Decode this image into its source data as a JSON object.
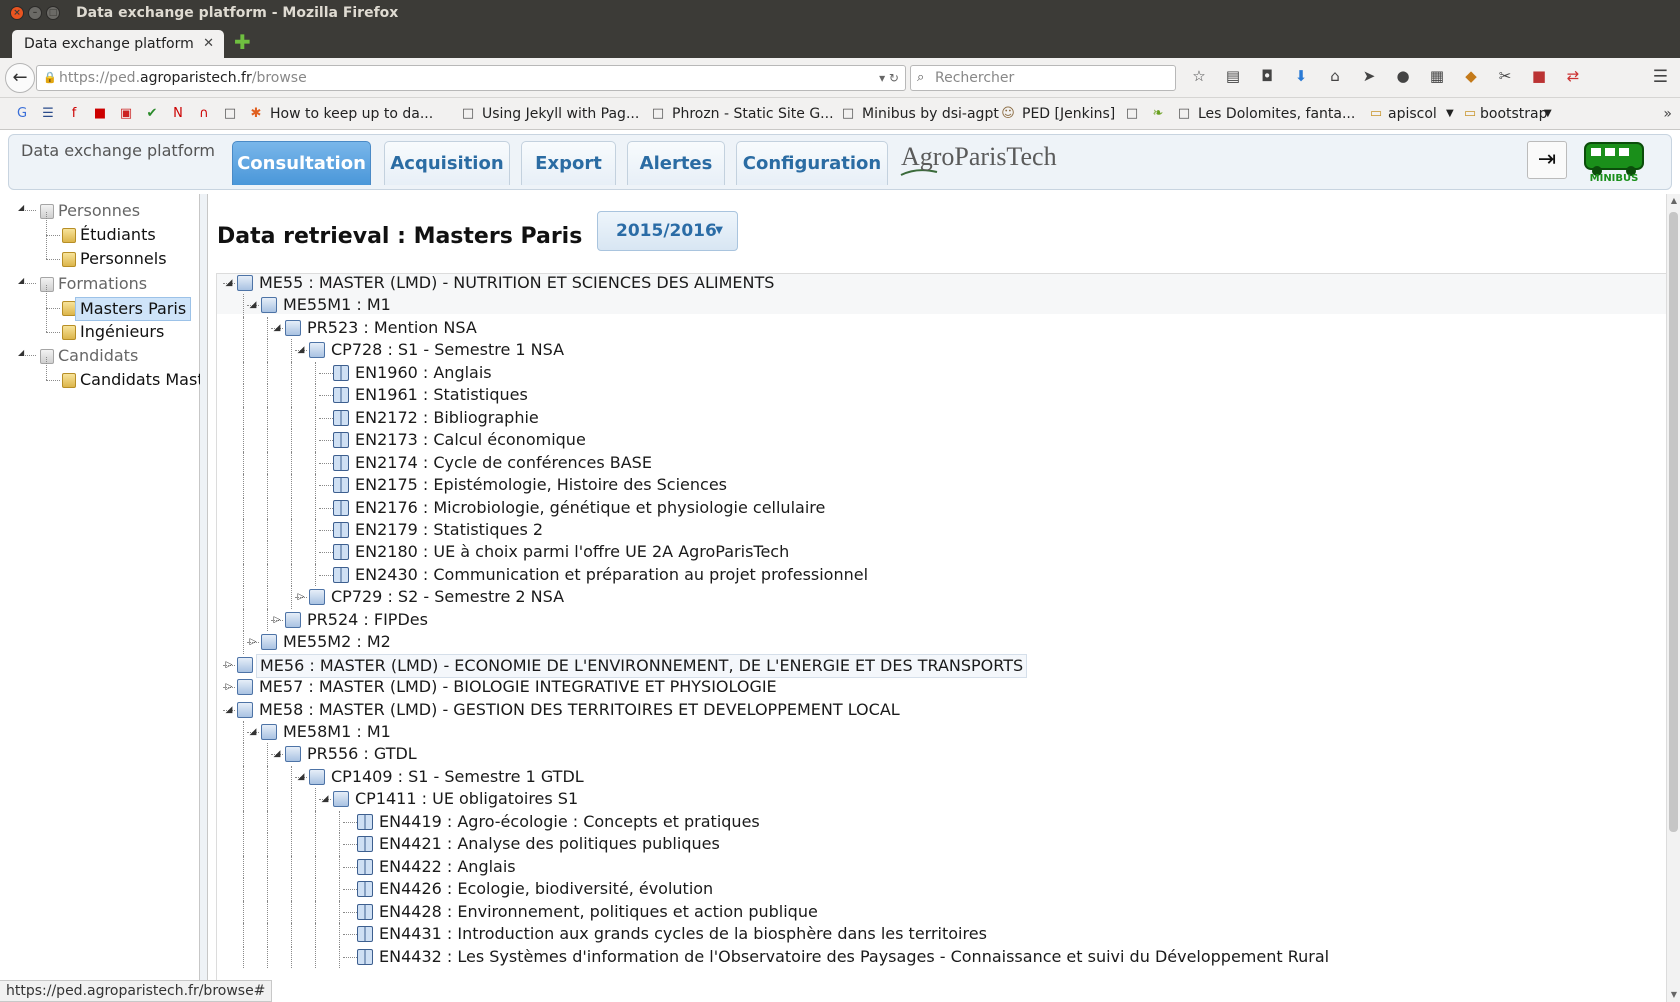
{
  "window": {
    "title": "Data exchange platform - Mozilla Firefox"
  },
  "browser": {
    "tab_title": "Data exchange platform",
    "url_prefix": "https://ped.",
    "url_domain": "agroparistech.fr",
    "url_path": "/browse",
    "search_placeholder": "Rechercher",
    "status_url": "https://ped.agroparistech.fr/browse#"
  },
  "bookmarks": [
    {
      "label": "",
      "icon": "google-translate-icon"
    },
    {
      "label": "",
      "icon": "form-icon"
    },
    {
      "label": "",
      "icon": "free-icon"
    },
    {
      "label": "",
      "icon": "bank-icon"
    },
    {
      "label": "",
      "icon": "pdf-icon"
    },
    {
      "label": "",
      "icon": "check-icon"
    },
    {
      "label": "",
      "icon": "n-icon"
    },
    {
      "label": "",
      "icon": "arch-icon"
    },
    {
      "label": "",
      "icon": "page-icon"
    },
    {
      "label": "How to keep up to da...",
      "icon": "blog-icon"
    },
    {
      "label": "Using Jekyll with Pag...",
      "icon": "page-icon"
    },
    {
      "label": "Phrozn - Static Site G...",
      "icon": "page-icon"
    },
    {
      "label": "Minibus by dsi-agpt",
      "icon": "page-icon"
    },
    {
      "label": "PED [Jenkins]",
      "icon": "jenkins-icon"
    },
    {
      "label": "",
      "icon": "page-icon"
    },
    {
      "label": "",
      "icon": "leaf-icon"
    },
    {
      "label": "Les Dolomites, fanta...",
      "icon": "page-icon"
    },
    {
      "label": "apiscol",
      "icon": "folder-icon"
    },
    {
      "label": "bootstrap",
      "icon": "folder-icon"
    }
  ],
  "app": {
    "brand": "Data exchange platform",
    "nav": [
      "Consultation",
      "Acquisition",
      "Export",
      "Alertes",
      "Configuration"
    ],
    "active_nav": "Consultation",
    "logo_text": "AgroParisTech",
    "bus_logo_text": "MINIBUS"
  },
  "left_tree": [
    {
      "label": "Personnes",
      "level": 0
    },
    {
      "label": "Étudiants",
      "level": 1
    },
    {
      "label": "Personnels",
      "level": 1
    },
    {
      "label": "Formations",
      "level": 0
    },
    {
      "label": "Masters Paris",
      "level": 1,
      "selected": true
    },
    {
      "label": "Ingénieurs",
      "level": 1
    },
    {
      "label": "Candidats",
      "level": 0
    },
    {
      "label": "Candidats Maste",
      "level": 1
    }
  ],
  "main": {
    "title": "Data retrieval : Masters Paris",
    "year": "2015/2016",
    "tree": [
      {
        "label": "ME55 : MASTER (LMD) - NUTRITION ET SCIENCES DES ALIMENTS",
        "level": 0,
        "toggle": "open",
        "icon": "node"
      },
      {
        "label": "ME55M1 : M1",
        "level": 1,
        "toggle": "open",
        "icon": "node"
      },
      {
        "label": "PR523 : Mention NSA",
        "level": 2,
        "toggle": "open",
        "icon": "node"
      },
      {
        "label": "CP728 : S1 - Semestre 1 NSA",
        "level": 3,
        "toggle": "open",
        "icon": "node"
      },
      {
        "label": "EN1960 : Anglais",
        "level": 4,
        "icon": "book"
      },
      {
        "label": "EN1961 : Statistiques",
        "level": 4,
        "icon": "book"
      },
      {
        "label": "EN2172 : Bibliographie",
        "level": 4,
        "icon": "book"
      },
      {
        "label": "EN2173 : Calcul économique",
        "level": 4,
        "icon": "book"
      },
      {
        "label": "EN2174 : Cycle de conférences BASE",
        "level": 4,
        "icon": "book"
      },
      {
        "label": "EN2175 : Epistémologie, Histoire des Sciences",
        "level": 4,
        "icon": "book"
      },
      {
        "label": "EN2176 : Microbiologie, génétique et physiologie cellulaire",
        "level": 4,
        "icon": "book"
      },
      {
        "label": "EN2179 : Statistiques 2",
        "level": 4,
        "icon": "book"
      },
      {
        "label": "EN2180 : UE à choix parmi l'offre UE 2A AgroParisTech",
        "level": 4,
        "icon": "book"
      },
      {
        "label": "EN2430 : Communication et préparation au projet professionnel",
        "level": 4,
        "icon": "book"
      },
      {
        "label": "CP729 : S2 - Semestre 2 NSA",
        "level": 3,
        "toggle": "closed",
        "icon": "node"
      },
      {
        "label": "PR524 : FIPDes",
        "level": 2,
        "toggle": "closed",
        "icon": "node"
      },
      {
        "label": "ME55M2 : M2",
        "level": 1,
        "toggle": "closed",
        "icon": "node"
      },
      {
        "label": "ME56 : MASTER (LMD) - ECONOMIE DE L'ENVIRONNEMENT, DE L'ENERGIE ET DES TRANSPORTS",
        "level": 0,
        "toggle": "closed",
        "icon": "node",
        "hover": true
      },
      {
        "label": "ME57 : MASTER (LMD) - BIOLOGIE INTEGRATIVE ET PHYSIOLOGIE",
        "level": 0,
        "toggle": "closed",
        "icon": "node"
      },
      {
        "label": "ME58 : MASTER (LMD) - GESTION DES TERRITOIRES ET DEVELOPPEMENT LOCAL",
        "level": 0,
        "toggle": "open",
        "icon": "node"
      },
      {
        "label": "ME58M1 : M1",
        "level": 1,
        "toggle": "open",
        "icon": "node"
      },
      {
        "label": "PR556 : GTDL",
        "level": 2,
        "toggle": "open",
        "icon": "node"
      },
      {
        "label": "CP1409 : S1 - Semestre 1 GTDL",
        "level": 3,
        "toggle": "open",
        "icon": "node"
      },
      {
        "label": "CP1411 : UE obligatoires S1",
        "level": 4,
        "toggle": "open",
        "icon": "node"
      },
      {
        "label": "EN4419 : Agro-écologie : Concepts et pratiques",
        "level": 5,
        "icon": "book"
      },
      {
        "label": "EN4421 : Analyse des politiques publiques",
        "level": 5,
        "icon": "book"
      },
      {
        "label": "EN4422 : Anglais",
        "level": 5,
        "icon": "book"
      },
      {
        "label": "EN4426 : Ecologie, biodiversité, évolution",
        "level": 5,
        "icon": "book"
      },
      {
        "label": "EN4428 : Environnement, politiques et action publique",
        "level": 5,
        "icon": "book"
      },
      {
        "label": "EN4431 : Introduction aux grands cycles de la biosphère dans les territoires",
        "level": 5,
        "icon": "book"
      },
      {
        "label": "EN4432 : Les Systèmes d'information de l'Observatoire des Paysages - Connaissance et suivi du Développement Rural",
        "level": 5,
        "icon": "book"
      }
    ]
  }
}
